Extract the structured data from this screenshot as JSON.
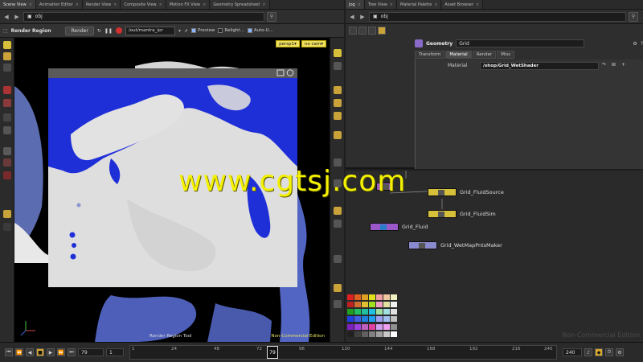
{
  "left_tabs": [
    "Scene View",
    "Animation Editor",
    "Render View",
    "Composite View",
    "Motion FX View",
    "Geometry Spreadsheet"
  ],
  "right_tabs": [
    "Jog",
    "Tree View",
    "Material Palette",
    "Asset Browser"
  ],
  "left_path": "obj",
  "right_path": "obj",
  "render_toolbar": {
    "title": "Render Region",
    "render_button": "Render",
    "output_path": "/out/mantra_ipr",
    "preview_label": "Preview",
    "relight_label": "Relight...",
    "autoupdate_label": "Auto-U..."
  },
  "viewport": {
    "camera": "persp1",
    "cam_menu": "no cam",
    "tool_label": "Render Region Tool",
    "edition_label": "Non-Commercial Edition"
  },
  "params": {
    "node_type": "Geometry",
    "node_name": "Grid",
    "tabs": [
      "Transform",
      "Material",
      "Render",
      "Misc"
    ],
    "active_tab": "Material",
    "material_label": "Material",
    "material_value": "/shop/Grid_WetShader"
  },
  "network": {
    "nodes": [
      {
        "label": "Grid_FluidSource"
      },
      {
        "label": "Grid_FluidSim"
      },
      {
        "label": "Grid_Fluid"
      },
      {
        "label": "Grid_WetMapPntsMaker"
      }
    ],
    "watermark": "Non-Commercial Edition"
  },
  "playbar": {
    "current_frame": "79",
    "start_frame": "1",
    "end_frame": "240",
    "ticks": [
      "1",
      "24",
      "48",
      "72",
      "96",
      "120",
      "144",
      "168",
      "192",
      "216",
      "240"
    ],
    "cursor_frame": "79"
  },
  "watermark_text": "www.cgtsj.com",
  "colors": {
    "fluid_blue": "#1f2fd8",
    "accent_yellow": "#f3f000",
    "node_purple": "#8a6bc9"
  }
}
